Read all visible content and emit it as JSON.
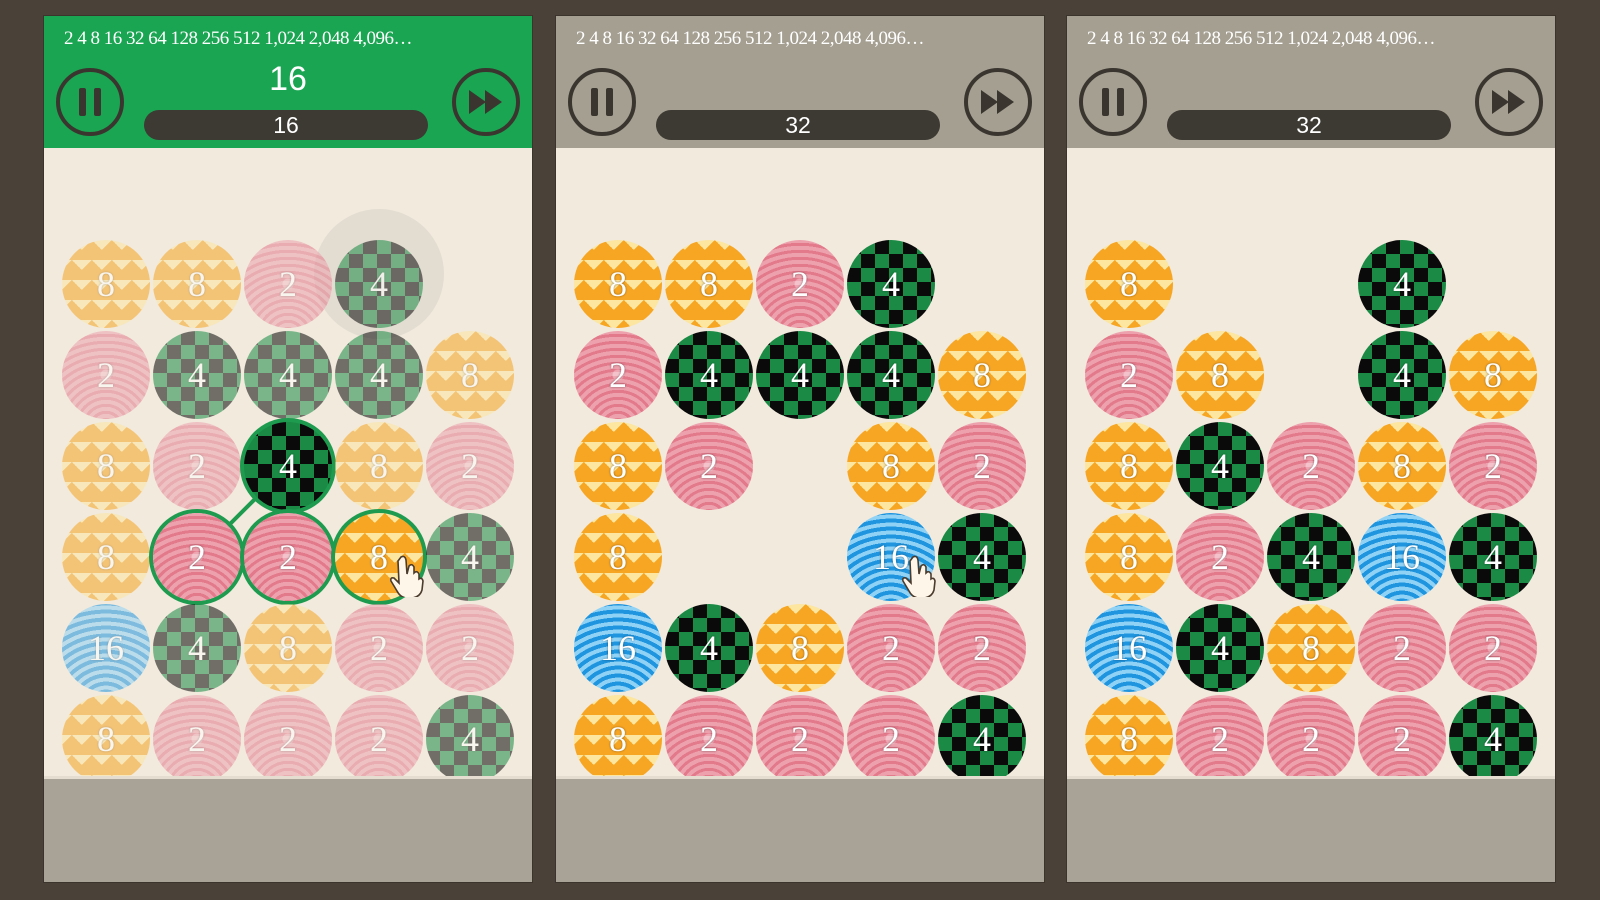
{
  "sequence_text": "2 4 8 16 32 64 128 256 512 1,024 2,048 4,096…",
  "panels": [
    {
      "active": true,
      "current_value": "16",
      "score": "16",
      "grid": [
        [
          "8",
          "8",
          "2",
          "4",
          ""
        ],
        [
          "2",
          "4",
          "4",
          "4",
          "8"
        ],
        [
          "8",
          "2",
          "4",
          "8",
          "2"
        ],
        [
          "8",
          "2",
          "2",
          "8",
          "4"
        ],
        [
          "16",
          "4",
          "8",
          "2",
          "2"
        ],
        [
          "8",
          "2",
          "2",
          "2",
          "4"
        ]
      ],
      "selected": [
        [
          2,
          2
        ],
        [
          3,
          1
        ],
        [
          3,
          2
        ],
        [
          3,
          3
        ]
      ]
    },
    {
      "active": false,
      "current_value": "",
      "score": "32",
      "grid": [
        [
          "8",
          "8",
          "2",
          "4",
          ""
        ],
        [
          "2",
          "4",
          "4",
          "4",
          "8"
        ],
        [
          "8",
          "2",
          "",
          "8",
          "2"
        ],
        [
          "8",
          "",
          "",
          "16",
          "4"
        ],
        [
          "16",
          "4",
          "8",
          "2",
          "2"
        ],
        [
          "8",
          "2",
          "2",
          "2",
          "4"
        ]
      ],
      "selected": []
    },
    {
      "active": false,
      "current_value": "",
      "score": "32",
      "grid": [
        [
          "8",
          "",
          "",
          "4",
          ""
        ],
        [
          "2",
          "8",
          "",
          "4",
          "8"
        ],
        [
          "8",
          "4",
          "2",
          "8",
          "2"
        ],
        [
          "8",
          "2",
          "4",
          "16",
          "4"
        ],
        [
          "16",
          "4",
          "8",
          "2",
          "2"
        ],
        [
          "8",
          "2",
          "2",
          "2",
          "4"
        ]
      ],
      "selected": []
    }
  ],
  "icons": {
    "pause": "pause-icon",
    "fast_forward": "fast-forward-icon",
    "hand_pointer": "hand-pointer-icon"
  },
  "colors": {
    "active_header": "#1aa552",
    "inactive_header": "#a59f92",
    "board_bg": "#f1eadd",
    "tile_2": "#e37a8c",
    "tile_4": "#1a8a45",
    "tile_8": "#f7a623",
    "tile_16": "#1f95df"
  }
}
